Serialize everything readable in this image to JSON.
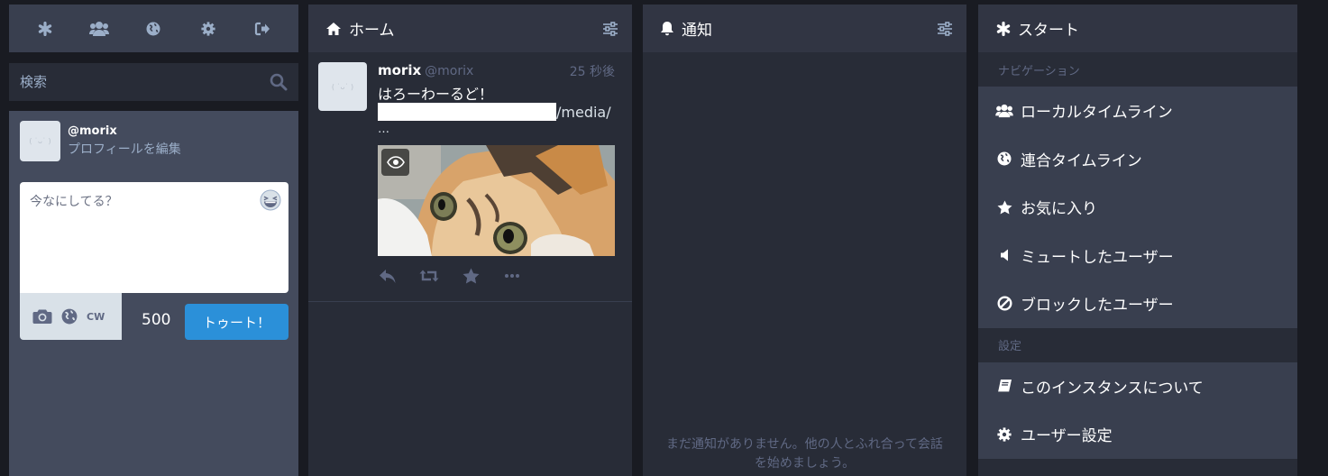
{
  "drawer": {
    "nav_icons": [
      "asterisk-icon",
      "users-icon",
      "globe-icon",
      "gear-icon",
      "sign-out-icon"
    ],
    "search_placeholder": "検索",
    "account": {
      "avatar_text": "( ˙ᴗ˙ )",
      "acct": "@morix",
      "edit_profile": "プロフィールを編集"
    },
    "compose": {
      "placeholder": "今なにしてる？",
      "cw_label": "CW",
      "counter": "500",
      "toot_label": "トゥート！"
    }
  },
  "home": {
    "title": "ホーム",
    "status": {
      "avatar_text": "( ˙ᴗ˙ )",
      "display_name": "morix",
      "username": "@morix",
      "time": "25 秒後",
      "text": "はろーわーるど！",
      "link_suffix": "/media/",
      "ellipsis": "…"
    }
  },
  "notifications": {
    "title": "通知",
    "empty_text": "まだ通知がありません。他の人とふれ合って会話を始めましょう。"
  },
  "getting_started": {
    "title": "スタート",
    "nav_section": "ナビゲーション",
    "nav_items": [
      {
        "icon": "users-icon",
        "label": "ローカルタイムライン"
      },
      {
        "icon": "globe-icon",
        "label": "連合タイムライン"
      },
      {
        "icon": "star-icon",
        "label": "お気に入り"
      },
      {
        "icon": "volume-off-icon",
        "label": "ミュートしたユーザー"
      },
      {
        "icon": "ban-icon",
        "label": "ブロックしたユーザー"
      }
    ],
    "settings_section": "設定",
    "settings_items": [
      {
        "icon": "book-icon",
        "label": "このインスタンスについて"
      },
      {
        "icon": "cog-icon",
        "label": "ユーザー設定"
      }
    ]
  },
  "colors": {
    "background": "#191b22",
    "column": "#282c37",
    "header": "#313543",
    "compose_bg": "#444b5d",
    "accent": "#2b90d9",
    "muted": "#606984",
    "secondary": "#9baec8"
  }
}
